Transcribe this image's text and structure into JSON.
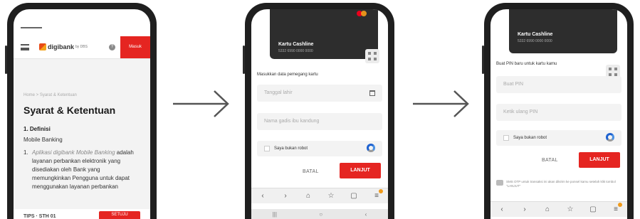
{
  "phone1": {
    "logo": {
      "name": "digibank",
      "sub": "by DBS"
    },
    "header": {
      "login_label": "Masuk",
      "menu_icon": "hamburger-icon",
      "help_icon": "help-icon"
    },
    "breadcrumb": "Home > Syarat & Ketentuan",
    "title": "Syarat & Ketentuan",
    "section_heading": "1. Definisi",
    "sub_heading": "Mobile Banking",
    "list_number": "1.",
    "list_emph": "Aplikasi digibank Mobile Banking",
    "list_text": "adalah layanan perbankan elektronik yang disediakan oleh Bank yang memungkinkan Pengguna untuk dapat menggunakan layanan perbankan",
    "footer_left": "TIPS · STH 01",
    "footer_button": "SETUJU"
  },
  "phone2": {
    "card_name": "Kartu Cashline",
    "card_number": "5332 6990 0000 0000",
    "form_title": "Masukkan data pemegang kartu",
    "dob_placeholder": "Tanggal lahir",
    "mother_placeholder": "Nama gadis ibu kandung",
    "captcha_label": "Saya bukan robot",
    "cancel_label": "BATAL",
    "continue_label": "LANJUT",
    "browser_icons": [
      "‹",
      "›",
      "⌂",
      "☆",
      "▢",
      "≡"
    ],
    "system_icons": [
      "|||",
      "○",
      "‹"
    ]
  },
  "phone3": {
    "card_name": "Kartu Cashline",
    "card_number": "5332 6990 0000 0000",
    "form_title": "Buat PIN baru untuk kartu kamu",
    "pin_placeholder": "Buat PIN",
    "repeat_placeholder": "Ketik ulang PIN",
    "captcha_label": "Saya bukan robot",
    "cancel_label": "BATAL",
    "continue_label": "LANJUT",
    "note": "SMS OTP untuk transaksi ini akan dikirim ke ponsel kamu setelah klik tombol \"LANJUT\"",
    "browser_icons": [
      "‹",
      "›",
      "⌂",
      "☆",
      "▢",
      "≡"
    ]
  },
  "colors": {
    "accent_red": "#e52521",
    "badge_orange": "#f09a1a",
    "card_dark": "#2d2d2d"
  }
}
